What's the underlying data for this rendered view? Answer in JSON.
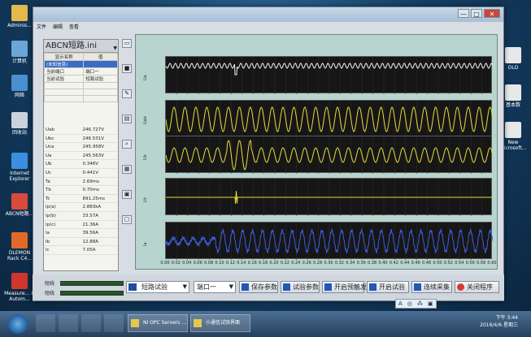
{
  "desktop": {
    "icons_left": [
      {
        "label": "Adminis...",
        "color": "#e7b84a"
      },
      {
        "label": "计算机",
        "color": "#6aa6d9"
      },
      {
        "label": "网络",
        "color": "#4a8fd0"
      },
      {
        "label": "回收站",
        "color": "#c9d3dc"
      },
      {
        "label": "Internet Explorer",
        "color": "#3a8fe0"
      },
      {
        "label": "ABCN短路...",
        "color": "#d94a3a"
      },
      {
        "label": "DLEMON Rack C4...",
        "color": "#e26a28"
      },
      {
        "label": "Measure... & Autom...",
        "color": "#d0362c"
      }
    ],
    "icons_right": [
      {
        "label": "OLD",
        "color": "#e8e8e8"
      },
      {
        "label": "基本数",
        "color": "#e8e8e8"
      },
      {
        "label": "New Microsoft...",
        "color": "#e8e8e8"
      }
    ]
  },
  "window": {
    "menu": [
      "文件",
      "编辑",
      "查看"
    ],
    "controls": {
      "minimize": "—",
      "maximize": "□",
      "close": "✕"
    }
  },
  "left_panel": {
    "file_name": "ABCN短路.ini",
    "param_headers": [
      "显示名称",
      "值"
    ],
    "params": [
      {
        "name": "(未知信息)",
        "value": ""
      },
      {
        "name": "当前端口",
        "value": "端口一"
      },
      {
        "name": "当前试验",
        "value": "短路试验"
      }
    ],
    "values": [
      {
        "name": "Uab",
        "value": "246.727V"
      },
      {
        "name": "Ubc",
        "value": "246.531V"
      },
      {
        "name": "Uca",
        "value": "245.958V"
      },
      {
        "name": "Ua",
        "value": "245.563V"
      },
      {
        "name": "Ub",
        "value": "0.346V"
      },
      {
        "name": "Uc",
        "value": "0.441V"
      },
      {
        "name": "Ta",
        "value": "2.69ms"
      },
      {
        "name": "Tb",
        "value": "0.70ms"
      },
      {
        "name": "Tc",
        "value": "891.25ms"
      },
      {
        "name": "Ip(a)",
        "value": "2.883kA"
      },
      {
        "name": "Ip(b)",
        "value": "33.57A"
      },
      {
        "name": "Ip(c)",
        "value": "21.36A"
      },
      {
        "name": "Ia",
        "value": "39.56A"
      },
      {
        "name": "Ib",
        "value": "12.88A"
      },
      {
        "name": "Ic",
        "value": "7.05A"
      }
    ]
  },
  "plots": {
    "ylabels": [
      "Ua",
      "Uab",
      "Ub",
      "Uc",
      "Ia"
    ],
    "x_ticks": [
      "0.00",
      "0.02",
      "0.04",
      "0.06",
      "0.08",
      "0.10",
      "0.12",
      "0.14",
      "0.16",
      "0.18",
      "0.20",
      "0.22",
      "0.24",
      "0.26",
      "0.28",
      "0.30",
      "0.32",
      "0.34",
      "0.36",
      "0.38",
      "0.40",
      "0.42",
      "0.44",
      "0.46",
      "0.48",
      "0.50",
      "0.52",
      "0.54",
      "0.56",
      "0.58",
      "0.60"
    ],
    "colors": {
      "white": "#f2f2f2",
      "yellow": "#e8dc3c",
      "blue": "#3d5de0"
    }
  },
  "bottom": {
    "status1": "短线",
    "status2": "短线",
    "test_select": "短路试验",
    "port_select": "端口一",
    "buttons": [
      "保存参数",
      "试验参数",
      "开启预触发",
      "开启试验",
      "连续采集",
      "关闭程序"
    ]
  },
  "ime": {
    "items": [
      "A",
      "◎",
      "⁂",
      "▣"
    ]
  },
  "taskbar": {
    "items": [
      "NI OPC Servers ...",
      "小通信试验界面"
    ],
    "time": "下午 3:44",
    "date": "2016/4/6 星期三"
  }
}
